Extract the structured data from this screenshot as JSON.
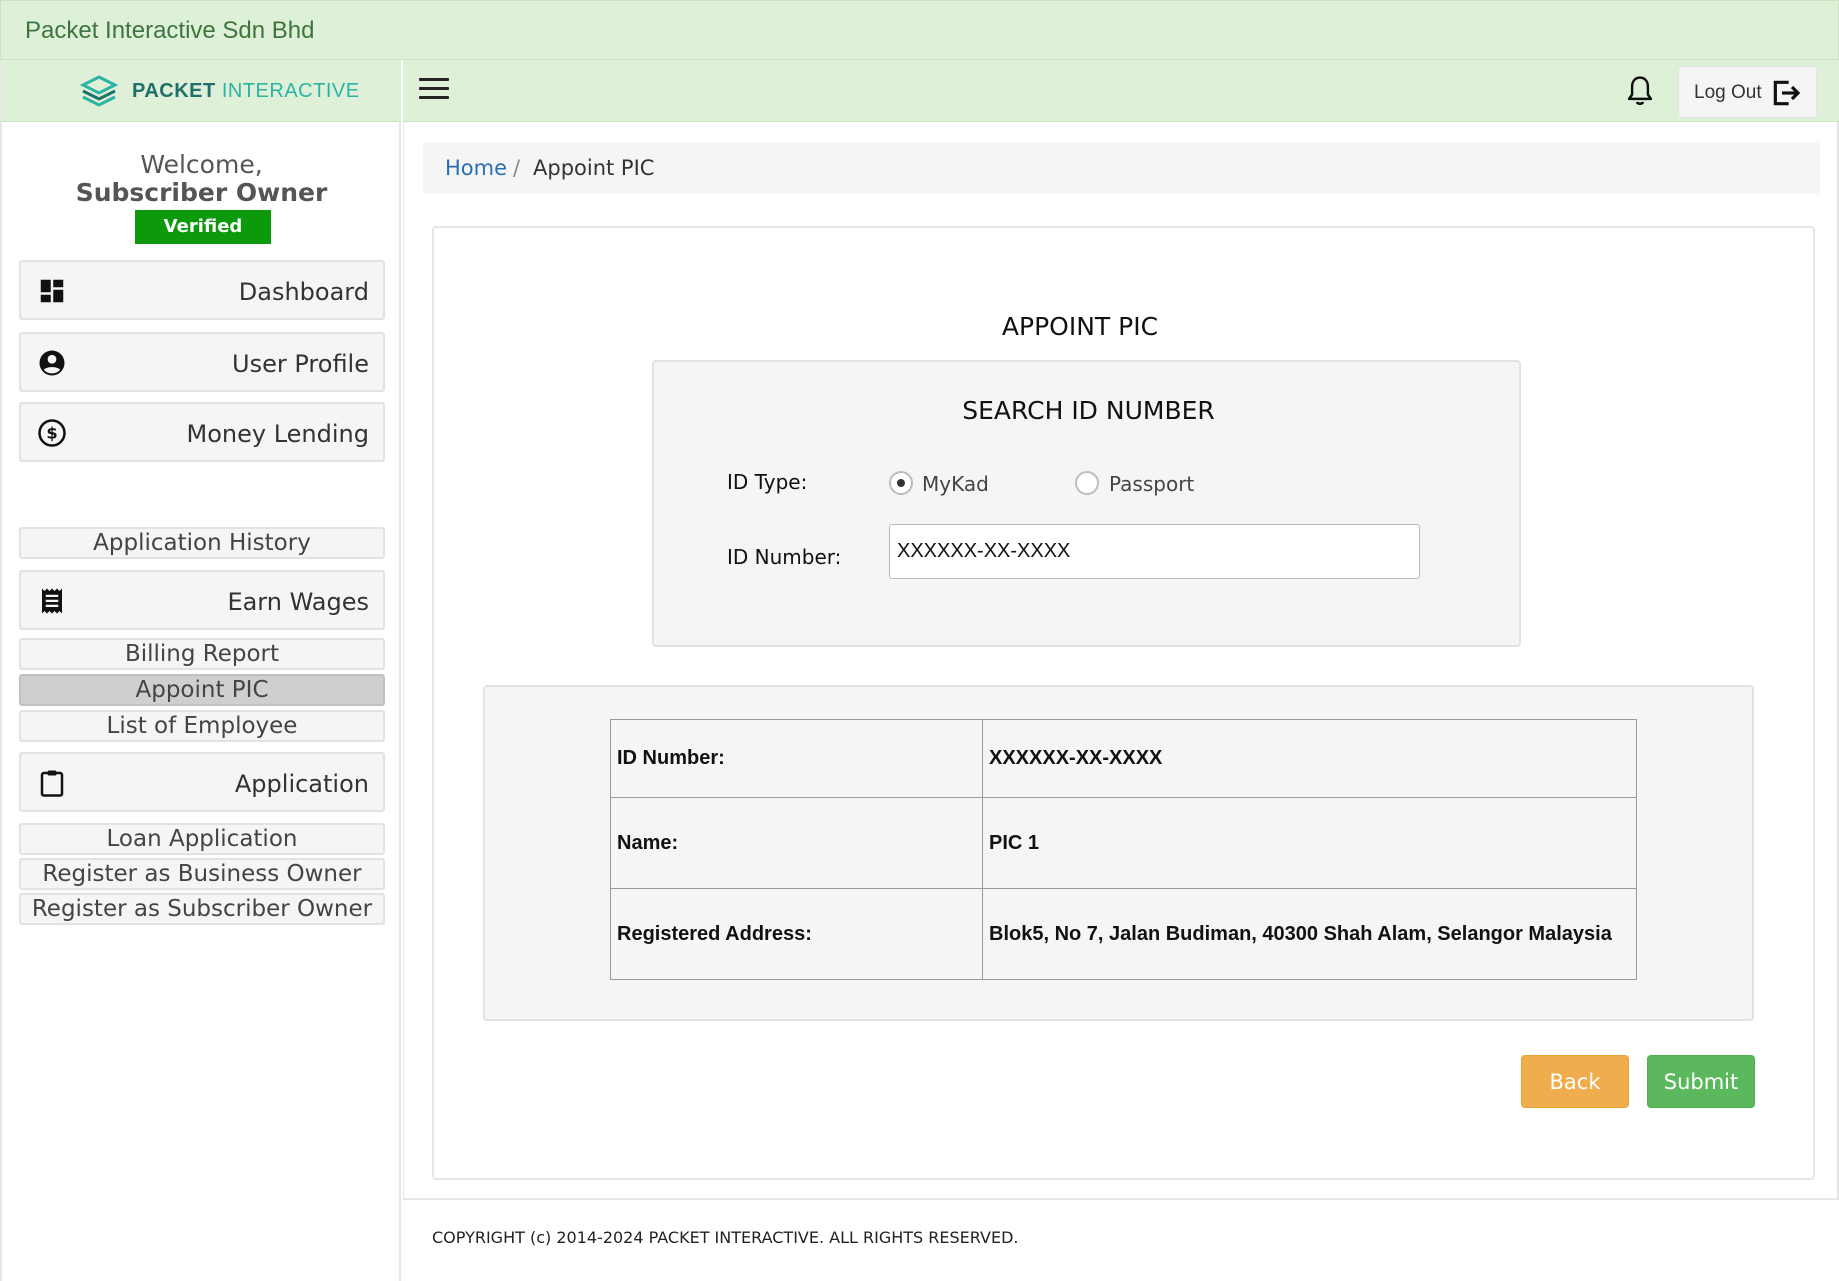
{
  "app": {
    "title": "Packet Interactive Sdn Bhd",
    "brand_bold": "PACKET",
    "brand_light": "INTERACTIVE"
  },
  "sidebar": {
    "welcome": "Welcome,",
    "user_role": "Subscriber Owner",
    "status_badge": "Verified",
    "items": [
      {
        "label": "Dashboard",
        "icon": "dashboard-icon"
      },
      {
        "label": "User Profile",
        "icon": "account-circle-icon"
      },
      {
        "label": "Money Lending",
        "icon": "dollar-circle-icon"
      },
      {
        "label": "Application History"
      },
      {
        "label": "Earn Wages",
        "icon": "receipt-icon"
      },
      {
        "label": "Billing Report"
      },
      {
        "label": "Appoint PIC",
        "active": true
      },
      {
        "label": "List of Employee"
      },
      {
        "label": "Application",
        "icon": "clipboard-icon"
      },
      {
        "label": "Loan Application"
      },
      {
        "label": "Register as Business Owner"
      },
      {
        "label": "Register as Subscriber Owner"
      }
    ]
  },
  "header": {
    "logout_label": "Log Out"
  },
  "breadcrumb": {
    "home": "Home",
    "separator": "/",
    "current": "Appoint PIC"
  },
  "main": {
    "page_title": "APPOINT PIC",
    "search": {
      "title": "SEARCH ID NUMBER",
      "id_type_label": "ID Type:",
      "options": [
        "MyKad",
        "Passport"
      ],
      "selected": "MyKad",
      "id_number_label": "ID Number:",
      "id_number_value": "XXXXXX-XX-XXXX"
    },
    "result": {
      "rows": [
        {
          "key": "ID Number:",
          "value": "XXXXXX-XX-XXXX"
        },
        {
          "key": "Name:",
          "value": "PIC 1"
        },
        {
          "key": "Registered Address:",
          "value": "Blok5, No 7, Jalan Budiman, 40300 Shah Alam, Selangor Malaysia"
        }
      ]
    },
    "back_label": "Back",
    "submit_label": "Submit"
  },
  "footer": {
    "copyright": "COPYRIGHT (c) 2014-2024 PACKET INTERACTIVE. ALL RIGHTS RESERVED."
  },
  "colors": {
    "header_bg": "#dff0d8",
    "verified": "#0c9a0c",
    "back": "#f0ad4e",
    "submit": "#5cb85c",
    "link": "#2a6fb3"
  }
}
